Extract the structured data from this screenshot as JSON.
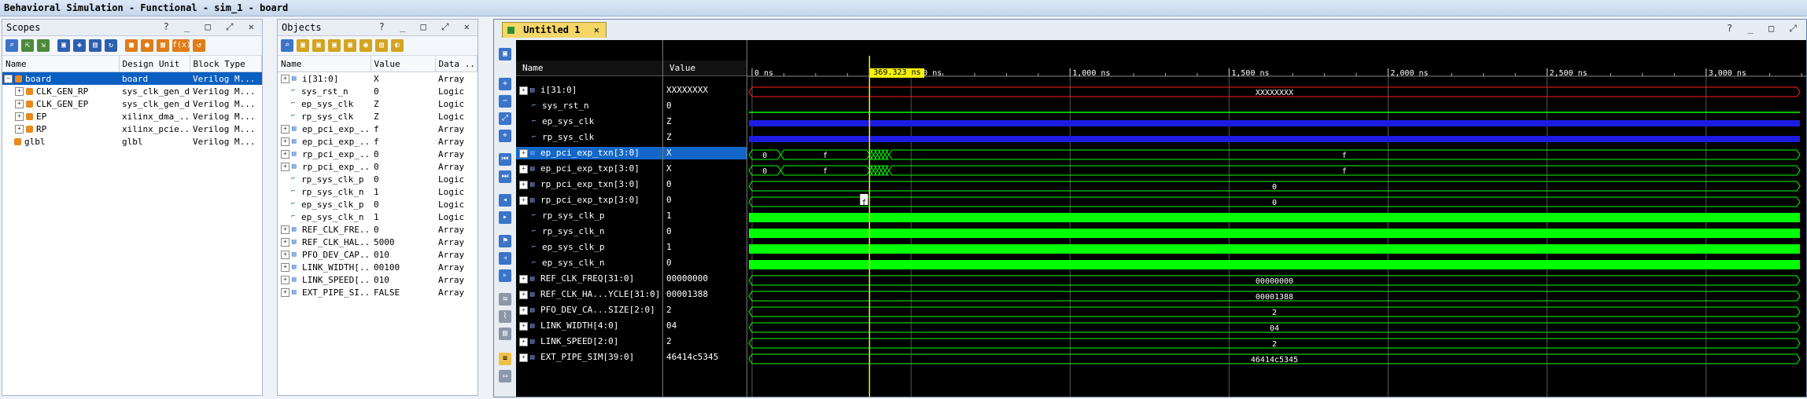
{
  "window": {
    "title": "Behavioral Simulation - Functional - sim_1 - board"
  },
  "scopes": {
    "title": "Scopes",
    "controls": "? _ □ ⤢ ✕",
    "columns": [
      "Name",
      "Design Unit",
      "Block Type"
    ],
    "rows": [
      {
        "name": "board",
        "unit": "board",
        "type": "Verilog M...",
        "indent": 0,
        "exp": "−",
        "selected": true
      },
      {
        "name": "CLK_GEN_RP",
        "unit": "sys_clk_gen_ds",
        "type": "Verilog M...",
        "indent": 1,
        "exp": "+"
      },
      {
        "name": "CLK_GEN_EP",
        "unit": "sys_clk_gen_ds",
        "type": "Verilog M...",
        "indent": 1,
        "exp": "+"
      },
      {
        "name": "EP",
        "unit": "xilinx_dma_...",
        "type": "Verilog M...",
        "indent": 1,
        "exp": "+"
      },
      {
        "name": "RP",
        "unit": "xilinx_pcie...",
        "type": "Verilog M...",
        "indent": 1,
        "exp": "+"
      },
      {
        "name": "glbl",
        "unit": "glbl",
        "type": "Verilog M...",
        "indent": 0,
        "exp": ""
      }
    ]
  },
  "objects": {
    "title": "Objects",
    "controls": "? _ □ ⤢ ✕",
    "columns": [
      "Name",
      "Value",
      "Data ..."
    ],
    "rows": [
      {
        "name": "i[31:0]",
        "value": "X",
        "type": "Array",
        "exp": "+"
      },
      {
        "name": "sys_rst_n",
        "value": "0",
        "type": "Logic",
        "exp": ""
      },
      {
        "name": "ep_sys_clk",
        "value": "Z",
        "type": "Logic",
        "exp": ""
      },
      {
        "name": "rp_sys_clk",
        "value": "Z",
        "type": "Logic",
        "exp": ""
      },
      {
        "name": "ep_pci_exp_...",
        "value": "f",
        "type": "Array",
        "exp": "+"
      },
      {
        "name": "ep_pci_exp_...",
        "value": "f",
        "type": "Array",
        "exp": "+"
      },
      {
        "name": "rp_pci_exp_...",
        "value": "0",
        "type": "Array",
        "exp": "+"
      },
      {
        "name": "rp_pci_exp_...",
        "value": "0",
        "type": "Array",
        "exp": "+"
      },
      {
        "name": "rp_sys_clk_p",
        "value": "0",
        "type": "Logic",
        "exp": ""
      },
      {
        "name": "rp_sys_clk_n",
        "value": "1",
        "type": "Logic",
        "exp": ""
      },
      {
        "name": "ep_sys_clk_p",
        "value": "0",
        "type": "Logic",
        "exp": ""
      },
      {
        "name": "ep_sys_clk_n",
        "value": "1",
        "type": "Logic",
        "exp": ""
      },
      {
        "name": "REF_CLK_FRE...",
        "value": "0",
        "type": "Array",
        "exp": "+"
      },
      {
        "name": "REF_CLK_HAL...",
        "value": "5000",
        "type": "Array",
        "exp": "+"
      },
      {
        "name": "PFO_DEV_CAP...",
        "value": "010",
        "type": "Array",
        "exp": "+"
      },
      {
        "name": "LINK_WIDTH[...",
        "value": "00100",
        "type": "Array",
        "exp": "+"
      },
      {
        "name": "LINK_SPEED[...",
        "value": "010",
        "type": "Array",
        "exp": "+"
      },
      {
        "name": "EXT_PIPE_SI...",
        "value": "FALSE",
        "type": "Array",
        "exp": "+"
      }
    ]
  },
  "wave": {
    "tab": "Untitled 1",
    "tab_close": "✕",
    "controls": "? _ □ ⤢",
    "name_header": "Name",
    "value_header": "Value",
    "cursor_label": "369.323 ns",
    "cursor_time": 369.323,
    "time_max": 3300,
    "ticks": [
      {
        "t": 0,
        "label": "0 ns"
      },
      {
        "t": 500,
        "label": "500 ns"
      },
      {
        "t": 1000,
        "label": "1,000 ns"
      },
      {
        "t": 1500,
        "label": "1,500 ns"
      },
      {
        "t": 2000,
        "label": "2,000 ns"
      },
      {
        "t": 2500,
        "label": "2,500 ns"
      },
      {
        "t": 3000,
        "label": "3,000 ns"
      }
    ],
    "colors": {
      "green": "#00ff00",
      "red": "#ff2020",
      "blue": "#1c1ce0",
      "cursor": "#f5f10a"
    },
    "signals": [
      {
        "name": "i[31:0]",
        "value": "XXXXXXXX",
        "kind": "bus-x",
        "bus": true,
        "label": "XXXXXXXX"
      },
      {
        "name": "sys_rst_n",
        "value": "0",
        "kind": "low",
        "bus": false
      },
      {
        "name": "ep_sys_clk",
        "value": "Z",
        "kind": "z",
        "bus": false
      },
      {
        "name": "rp_sys_clk",
        "value": "Z",
        "kind": "z",
        "bus": false
      },
      {
        "name": "ep_pci_exp_txn[3:0]",
        "value": "X",
        "kind": "bus-mixed",
        "bus": true,
        "selected": true,
        "a": "0",
        "b": "f",
        "c": "f"
      },
      {
        "name": "ep_pci_exp_txp[3:0]",
        "value": "X",
        "kind": "bus-mixed",
        "bus": true,
        "a": "0",
        "b": "f",
        "c": "f"
      },
      {
        "name": "rp_pci_exp_txn[3:0]",
        "value": "0",
        "kind": "bus",
        "bus": true,
        "label": "0"
      },
      {
        "name": "rp_pci_exp_txp[3:0]",
        "value": "0",
        "kind": "bus",
        "bus": true,
        "label": "0",
        "marker": "f"
      },
      {
        "name": "rp_sys_clk_p",
        "value": "1",
        "kind": "clk",
        "bus": false
      },
      {
        "name": "rp_sys_clk_n",
        "value": "0",
        "kind": "clk",
        "bus": false
      },
      {
        "name": "ep_sys_clk_p",
        "value": "1",
        "kind": "clk",
        "bus": false
      },
      {
        "name": "ep_sys_clk_n",
        "value": "0",
        "kind": "clk",
        "bus": false
      },
      {
        "name": "REF_CLK_FREQ[31:0]",
        "value": "00000000",
        "kind": "bus",
        "bus": true,
        "label": "00000000"
      },
      {
        "name": "REF_CLK_HA...YCLE[31:0]",
        "value": "00001388",
        "kind": "bus",
        "bus": true,
        "label": "00001388"
      },
      {
        "name": "PFO_DEV_CA...SIZE[2:0]",
        "value": "2",
        "kind": "bus",
        "bus": true,
        "label": "2"
      },
      {
        "name": "LINK_WIDTH[4:0]",
        "value": "04",
        "kind": "bus",
        "bus": true,
        "label": "04"
      },
      {
        "name": "LINK_SPEED[2:0]",
        "value": "2",
        "kind": "bus",
        "bus": true,
        "label": "2"
      },
      {
        "name": "EXT_PIPE_SIM[39:0]",
        "value": "46414c5345",
        "kind": "bus",
        "bus": true,
        "label": "46414c5345"
      }
    ]
  }
}
